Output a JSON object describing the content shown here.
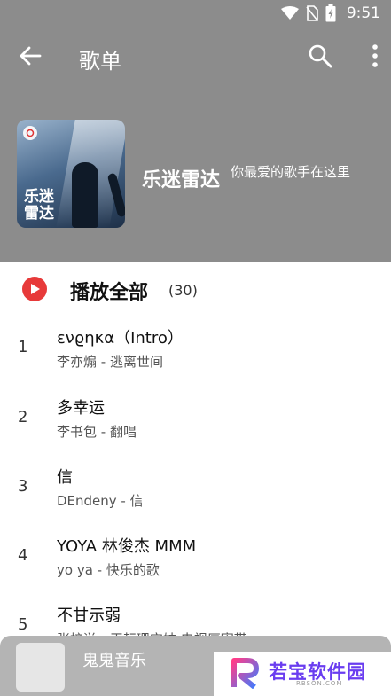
{
  "status_bar": {
    "time": "9:51",
    "icons": [
      "wifi-icon",
      "no-sim-icon",
      "battery-charging-icon"
    ]
  },
  "toolbar": {
    "title": "歌单",
    "back_icon": "arrow-left-icon",
    "search_icon": "search-icon",
    "more_icon": "more-vert-icon"
  },
  "playlist": {
    "cover_text": "乐迷雷达",
    "name": "乐迷雷达",
    "description": "你最爱的歌手在这里"
  },
  "play_all": {
    "label": "播放全部",
    "count": "(30)",
    "icon": "play-circle-icon",
    "accent_color": "#e73a3a"
  },
  "songs": [
    {
      "index": "1",
      "title": "ɛνϱηκα（Intro）",
      "subtitle": "李亦煽 - 逃离世间"
    },
    {
      "index": "2",
      "title": "多幸运",
      "subtitle": "李书包 - 翻唱"
    },
    {
      "index": "3",
      "title": "信",
      "subtitle": "DEndeny - 信"
    },
    {
      "index": "4",
      "title": "YOYA 林俊杰 MMM",
      "subtitle": "yo ya - 快乐的歌"
    },
    {
      "index": "5",
      "title": "不甘示弱",
      "subtitle": "张梓溢 - 王耘珊宝妹 电视厘寄带"
    }
  ],
  "mini_player": {
    "title": "鬼鬼音乐"
  },
  "watermark": {
    "text": "若宝软件园",
    "url": "RBSON.COM"
  },
  "colors": {
    "header_bg": "#8c8c8c",
    "mini_player_bg": "#b4b4b4"
  }
}
